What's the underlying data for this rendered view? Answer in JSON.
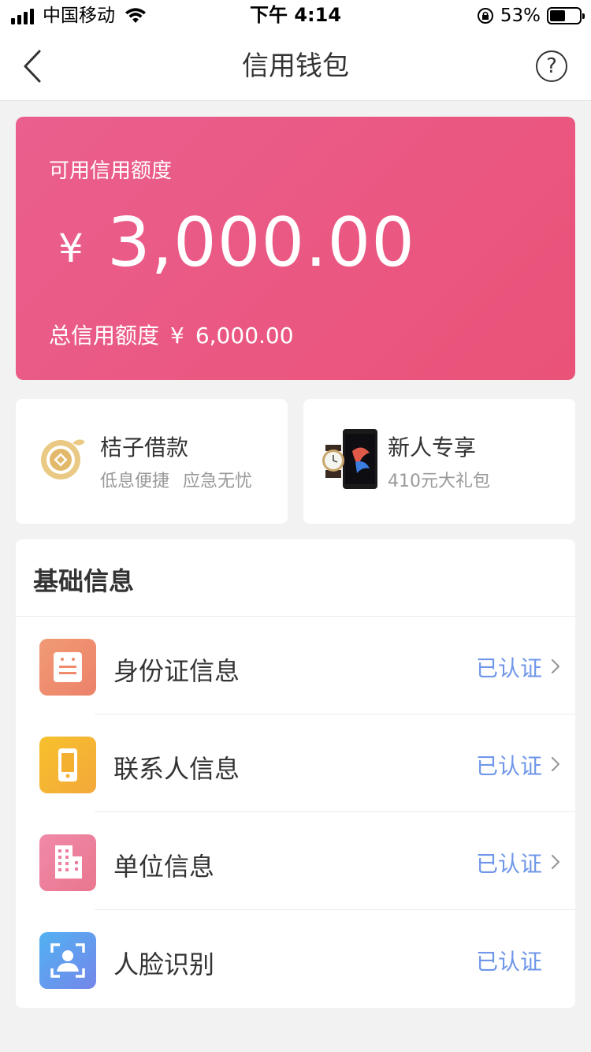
{
  "status_bar": {
    "carrier": "中国移动",
    "time": "下午 4:14",
    "battery": "53%"
  },
  "nav": {
    "title": "信用钱包",
    "help_symbol": "?"
  },
  "credit": {
    "available_label": "可用信用额度",
    "currency_symbol": "¥",
    "available_amount": "3,000.00",
    "total_label": "总信用额度",
    "total_currency": "¥",
    "total_amount": "6,000.00",
    "gradient_start": "#ea5f8e",
    "gradient_end": "#ea5278"
  },
  "promos": [
    {
      "title": "桔子借款",
      "subtitle": "低息便捷 应急无忧",
      "icon": "orange-coin-icon"
    },
    {
      "title": "新人专享",
      "subtitle": "410元大礼包",
      "icon": "phone-watch-image"
    }
  ],
  "basic_info": {
    "title": "基础信息",
    "items": [
      {
        "label": "身份证信息",
        "status": "已认证",
        "icon": "id-card-icon",
        "color": "#ef8f6e",
        "has_arrow": true
      },
      {
        "label": "联系人信息",
        "status": "已认证",
        "icon": "phone-icon",
        "color": "#f5b52e",
        "has_arrow": true
      },
      {
        "label": "单位信息",
        "status": "已认证",
        "icon": "building-icon",
        "color": "#ec7f9e",
        "has_arrow": true
      },
      {
        "label": "人脸识别",
        "status": "已认证",
        "icon": "face-scan-icon",
        "color": "#5aa6f0",
        "has_arrow": false
      }
    ]
  }
}
